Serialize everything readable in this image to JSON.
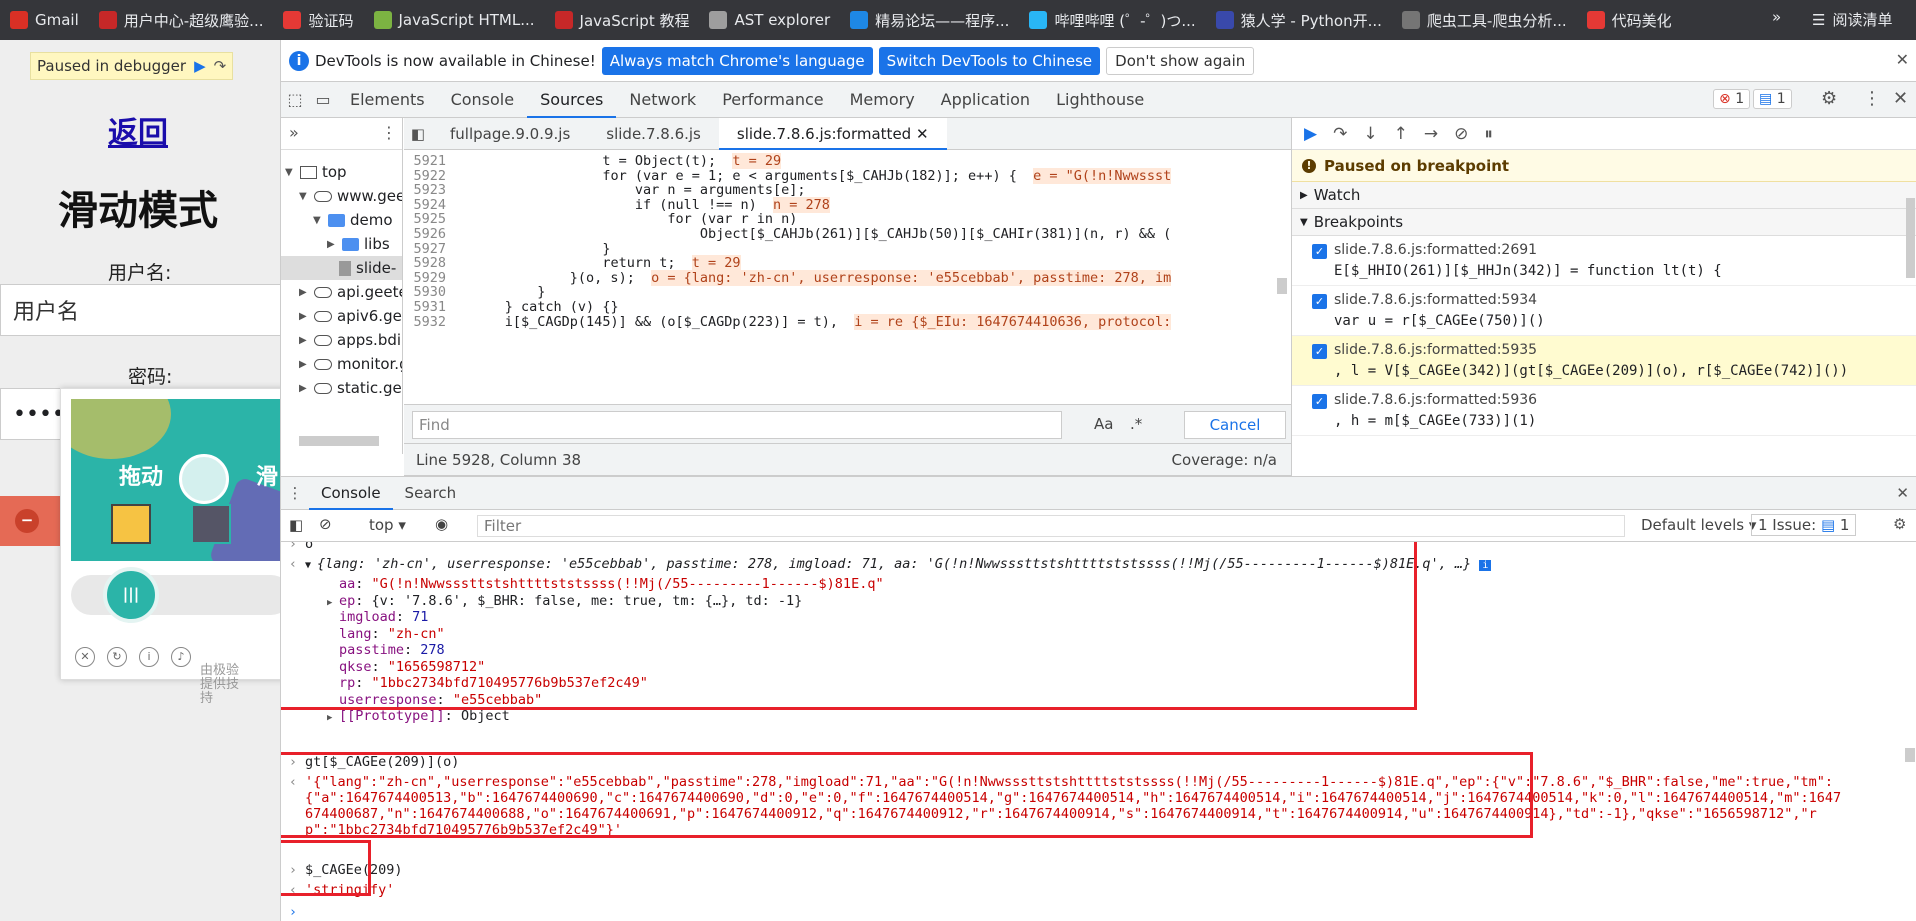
{
  "bookmarks": {
    "items": [
      {
        "label": "Gmail",
        "color": "#d93025"
      },
      {
        "label": "用户中心-超级鹰验...",
        "color": "#c62828"
      },
      {
        "label": "验证码",
        "color": "#e53935"
      },
      {
        "label": "JavaScript HTML...",
        "color": "#7cb342"
      },
      {
        "label": "JavaScript 教程",
        "color": "#c62828"
      },
      {
        "label": "AST explorer",
        "color": "#9e9e9e"
      },
      {
        "label": "精易论坛——程序...",
        "color": "#1e88e5"
      },
      {
        "label": "哔哩哔哩 (゜-゜)つ...",
        "color": "#29b6f6"
      },
      {
        "label": "猿人学 - Python开...",
        "color": "#3949ab"
      },
      {
        "label": "爬虫工具-爬虫分析...",
        "color": "#757575"
      },
      {
        "label": "代码美化",
        "color": "#e53935"
      }
    ],
    "more": "»",
    "reading_list": "阅读清单"
  },
  "webpage": {
    "paused_label": "Paused in debugger",
    "back_link": "返回",
    "title": "滑动模式",
    "username_label": "用户名:",
    "username_placeholder": "用户名",
    "password_label": "密码:",
    "password_value": "••••••",
    "captcha_text_left": "拖动",
    "captcha_text_right": "滑",
    "captcha_provided": "由极验提供技持"
  },
  "infobar": {
    "message": "DevTools is now available in Chinese!",
    "btn_match": "Always match Chrome's language",
    "btn_switch": "Switch DevTools to Chinese",
    "btn_dismiss": "Don't show again"
  },
  "devtools_tabs": [
    "Elements",
    "Console",
    "Sources",
    "Network",
    "Performance",
    "Memory",
    "Application",
    "Lighthouse"
  ],
  "badges": {
    "errors": "1",
    "messages": "1"
  },
  "navigator": {
    "top": "top",
    "domains": [
      "www.geet",
      "api.geetes",
      "apiv6.geet",
      "apps.bdim",
      "monitor.g",
      "static.geet"
    ],
    "folder_demo": "demo",
    "folder_libs": "libs",
    "file_slide": "slide-"
  },
  "editor": {
    "tabs": [
      "fullpage.9.0.9.js",
      "slide.7.8.6.js",
      "slide.7.8.6.js:formatted"
    ],
    "lines": [
      {
        "n": "5921",
        "indent": 18,
        "code": "t = Object(t);",
        "inline": "t = 29"
      },
      {
        "n": "5922",
        "indent": 18,
        "code": "for (var e = 1; e < arguments[$_CAHJb(182)]; e++) {",
        "inline": "e = \"G(!n!Nwwssst"
      },
      {
        "n": "5923",
        "indent": 22,
        "code": "var n = arguments[e];",
        "inline": ""
      },
      {
        "n": "5924",
        "indent": 22,
        "code": "if (null !== n)",
        "inline": "n = 278"
      },
      {
        "n": "5925",
        "indent": 26,
        "code": "for (var r in n)",
        "inline": ""
      },
      {
        "n": "5926",
        "indent": 30,
        "code": "Object[$_CAHJb(261)][$_CAHJb(50)][$_CAHIr(381)](n, r) && (",
        "inline": ""
      },
      {
        "n": "5927",
        "indent": 18,
        "code": "}",
        "inline": ""
      },
      {
        "n": "5928",
        "indent": 18,
        "code": "return t;",
        "inline": "t = 29"
      },
      {
        "n": "5929",
        "indent": 14,
        "code": "}(o, s);",
        "inline": "o = {lang: 'zh-cn', userresponse: 'e55cebbab', passtime: 278, im"
      },
      {
        "n": "5930",
        "indent": 10,
        "code": "}",
        "inline": ""
      },
      {
        "n": "5931",
        "indent": 6,
        "code": "} catch (v) {}",
        "inline": ""
      },
      {
        "n": "5932",
        "indent": 6,
        "code": "i[$_CAGDp(145)] && (o[$_CAGDp(223)] = t),",
        "inline": "i = re {$_EIu: 1647674410636, protocol:"
      }
    ],
    "find_placeholder": "Find",
    "find_aa": "Aa",
    "find_regex": ".*",
    "find_cancel": "Cancel",
    "status_position": "Line 5928, Column 38",
    "status_coverage": "Coverage: n/a"
  },
  "debugger": {
    "paused_banner": "Paused on breakpoint",
    "watch": "Watch",
    "breakpoints_header": "Breakpoints",
    "breakpoints": [
      {
        "file": "slide.7.8.6.js:formatted:2691",
        "code": "E[$_HHIO(261)][$_HHJn(342)] = function lt(t) {",
        "highlight": false
      },
      {
        "file": "slide.7.8.6.js:formatted:5934",
        "code": "var u = r[$_CAGEe(750)]()",
        "highlight": false
      },
      {
        "file": "slide.7.8.6.js:formatted:5935",
        "code": ", l = V[$_CAGEe(342)](gt[$_CAGEe(209)](o), r[$_CAGEe(742)]())",
        "highlight": true
      },
      {
        "file": "slide.7.8.6.js:formatted:5936",
        "code": ", h = m[$_CAGEe(733)](1)",
        "highlight": false
      }
    ]
  },
  "drawer": {
    "tabs": [
      "Console",
      "Search"
    ],
    "context": "top",
    "filter_placeholder": "Filter",
    "levels": "Default levels",
    "issues": "1 Issue:",
    "issues_count": "1"
  },
  "console": {
    "prev_input": "o",
    "object_summary": "{lang: 'zh-cn', userresponse: 'e55cebbab', passtime: 278, imgload: 71, aa: 'G(!n!Nwwsssttstshttttststssss(!!Mj(/55---------1------$)81E.q', …}",
    "props": [
      {
        "key": "aa",
        "value": "\"G(!n!Nwwsssttstshttttststssss(!!Mj(/55---------1------$)81E.q\"",
        "type": "str"
      },
      {
        "key": "ep",
        "value": "{v: '7.8.6', $_BHR: false, me: true, tm: {…}, td: -1}",
        "type": "obj"
      },
      {
        "key": "imgload",
        "value": "71",
        "type": "num"
      },
      {
        "key": "lang",
        "value": "\"zh-cn\"",
        "type": "str"
      },
      {
        "key": "passtime",
        "value": "278",
        "type": "num"
      },
      {
        "key": "qkse",
        "value": "\"1656598712\"",
        "type": "str"
      },
      {
        "key": "rp",
        "value": "\"1bbc2734bfd710495776b9b537ef2c49\"",
        "type": "str"
      },
      {
        "key": "userresponse",
        "value": "\"e55cebbab\"",
        "type": "str"
      },
      {
        "key": "[[Prototype]]",
        "value": "Object",
        "type": "proto"
      }
    ],
    "input_stringify": "gt[$_CAGEe(209)](o)",
    "result_lines": [
      "'{\"lang\":\"zh-cn\",\"userresponse\":\"e55cebbab\",\"passtime\":278,\"imgload\":71,\"aa\":\"G(!n!Nwwsssttstshttttststssss(!!Mj(/55---------1------$)81E.q\",\"ep\":{\"v\":\"7.8.6\",\"$_BHR\":false,\"me\":true,\"tm\":",
      "{\"a\":1647674400513,\"b\":1647674400690,\"c\":1647674400690,\"d\":0,\"e\":0,\"f\":1647674400514,\"g\":1647674400514,\"h\":1647674400514,\"i\":1647674400514,\"j\":1647674400514,\"k\":0,\"l\":1647674400514,\"m\":1647",
      "674400687,\"n\":1647674400688,\"o\":1647674400691,\"p\":1647674400912,\"q\":1647674400912,\"r\":1647674400914,\"s\":1647674400914,\"t\":1647674400914,\"u\":1647674400914},\"td\":-1},\"qkse\":\"1656598712\",\"r",
      "p\":\"1bbc2734bfd710495776b9b537ef2c49\"}'"
    ],
    "input_fn": "$_CAGEe(209)",
    "result_fn": "'stringify'"
  },
  "colors": {
    "accent": "#1a73e8",
    "highlight_box": "#e8202a"
  }
}
